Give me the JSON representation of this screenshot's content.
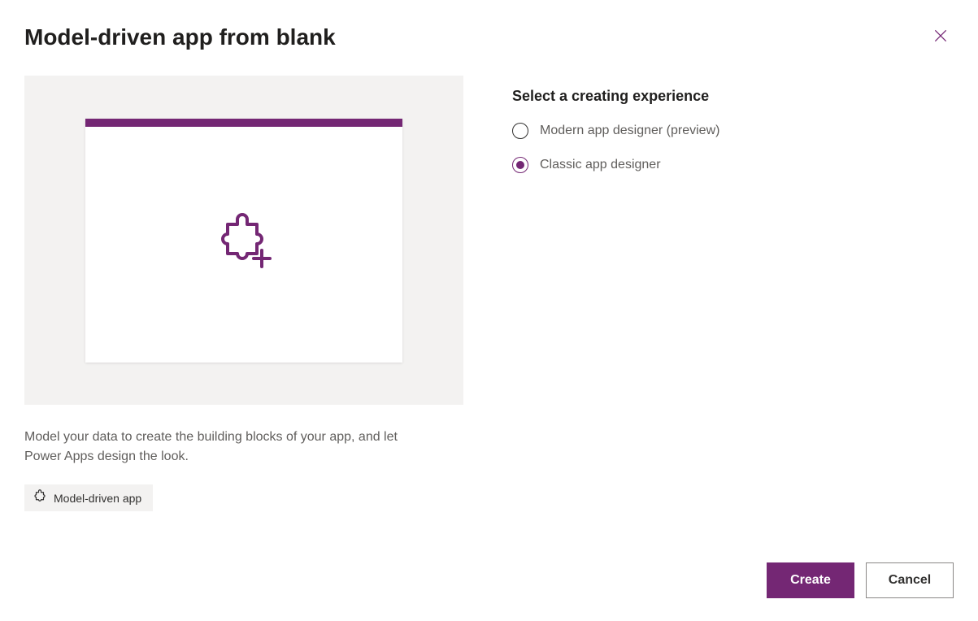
{
  "dialog": {
    "title": "Model-driven app from blank",
    "description": "Model your data to create the building blocks of your app, and let Power Apps design the look.",
    "tag_label": "Model-driven app"
  },
  "options": {
    "section_title": "Select a creating experience",
    "modern_label": "Modern app designer (preview)",
    "classic_label": "Classic app designer"
  },
  "footer": {
    "create_label": "Create",
    "cancel_label": "Cancel"
  }
}
